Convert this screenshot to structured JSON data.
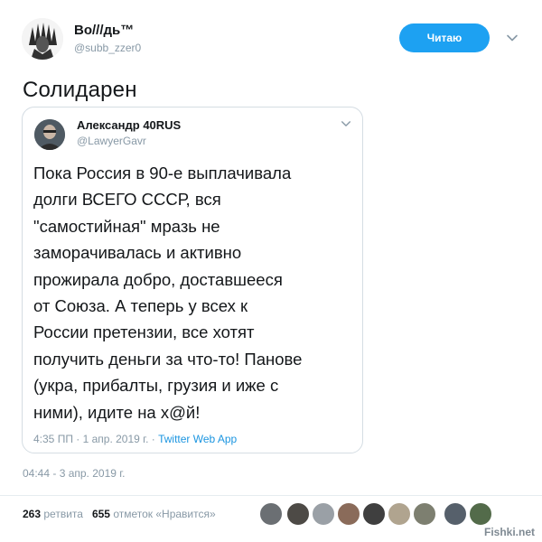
{
  "tweet": {
    "author": {
      "name": "Во///дь™",
      "handle": "@subb_zzer0"
    },
    "follow_button_label": "Читаю",
    "text": "Солидарен",
    "timestamp": "04:44 - 3 апр. 2019 г.",
    "stats": {
      "retweets_count": "263",
      "retweets_label": "ретвита",
      "likes_count": "655",
      "likes_label": "отметок «Нравится»"
    },
    "liker_colors": [
      "#6b6f73",
      "#4d4a46",
      "#9aa0a6",
      "#8a6b5a",
      "#3f3f3f",
      "#b0a48f",
      "#7d7f70",
      "#56606b",
      "#536b4a"
    ]
  },
  "quoted_tweet": {
    "author": {
      "name": "Александр 40RUS",
      "handle": "@LawyerGavr"
    },
    "body_lines": [
      "Пока Россия в 90-е выплачивала",
      "долги ВСЕГО СССР, вся",
      "\"самостийная\" мразь не",
      "заморачивалась и активно",
      "прожирала добро, доставшееся",
      "от Союза. А теперь у всех к",
      "России претензии, все хотят",
      "получить деньги за что-то! Панове",
      "(укра, прибалты, грузия и иже с",
      "ними), идите на х@й!"
    ],
    "meta_time": "4:35 ПП · 1 апр. 2019 г. · ",
    "via": "Twitter Web App"
  },
  "watermark": "Fishki.net"
}
